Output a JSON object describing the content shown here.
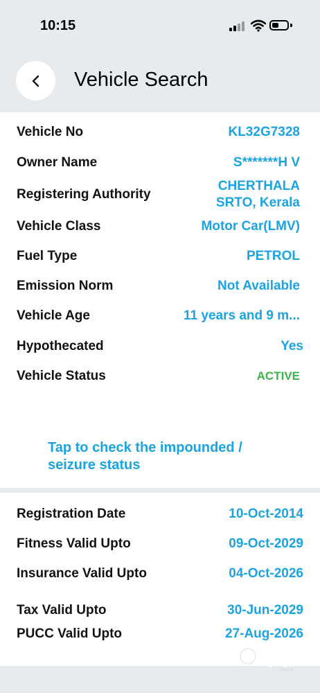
{
  "status_bar": {
    "time": "10:15"
  },
  "header": {
    "title": "Vehicle Search"
  },
  "details": {
    "vehicle_no_label": "Vehicle No",
    "vehicle_no": "KL32G7328",
    "owner_name_label": "Owner Name",
    "owner_name": "S*******H V",
    "registering_authority_label": "Registering Authority",
    "registering_authority_line1": "CHERTHALA",
    "registering_authority_line2": "SRTO, Kerala",
    "vehicle_class_label": "Vehicle Class",
    "vehicle_class": "Motor Car(LMV)",
    "fuel_type_label": "Fuel Type",
    "fuel_type": "PETROL",
    "emission_norm_label": "Emission Norm",
    "emission_norm": "Not Available",
    "vehicle_age_label": "Vehicle Age",
    "vehicle_age": "11 years and 9 m...",
    "hypothecated_label": "Hypothecated",
    "hypothecated": "Yes",
    "vehicle_status_label": "Vehicle Status",
    "vehicle_status": "ACTIVE",
    "status_color": "#3cb54a"
  },
  "impound_link": {
    "line1": "Tap to check the impounded /",
    "line2": "seizure status"
  },
  "validity": {
    "registration_date_label": "Registration Date",
    "registration_date": "10-Oct-2014",
    "fitness_label": "Fitness Valid Upto",
    "fitness": "09-Oct-2029",
    "insurance_label": "Insurance Valid Upto",
    "insurance": "04-Oct-2026",
    "tax_label": "Tax Valid Upto",
    "tax": "30-Jun-2029",
    "pucc_label": "PUCC Valid Upto",
    "pucc": "27-Aug-2026"
  },
  "watermark": {
    "brand": "olx",
    "sub": "INDIA"
  },
  "colors": {
    "accent": "#1ba3e2",
    "background": "#e8ebee"
  }
}
